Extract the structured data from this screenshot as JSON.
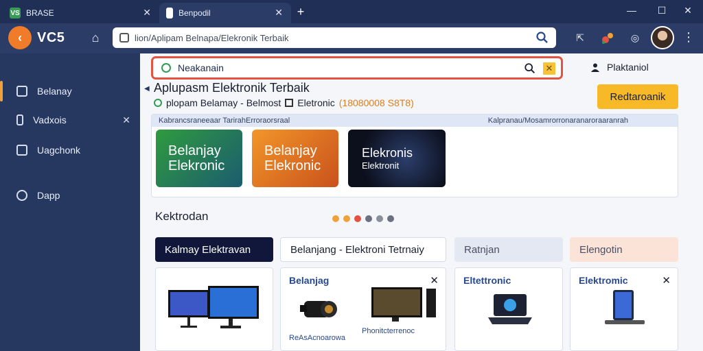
{
  "tabs": [
    {
      "label": "BRASE",
      "favicon": "VS"
    },
    {
      "label": "Benpodil",
      "favicon": ""
    }
  ],
  "toolbar": {
    "logo_text": "VC5",
    "address": "lion/Aplipam Belnapa/Elekronik Terbaik"
  },
  "sidebar": {
    "items": [
      {
        "label": "Belanay"
      },
      {
        "label": "Vadxois"
      },
      {
        "label": "Uagchonk"
      },
      {
        "label": "Dapp"
      }
    ]
  },
  "main": {
    "search_value": "Neakanain",
    "user_link": "Plaktaniol",
    "headline": "Aplupasm Elektronik Terbaik",
    "subline": {
      "part1": "plopam Belamay - Belmost",
      "part2": "Eletronic",
      "number": "(18080008 S8T8)"
    },
    "cta_label": "Redtaroanik",
    "banner": {
      "head_left": "Kabrancsraneeaar TarirahErroraorsraal",
      "head_right": "Kalpranau/Mosamrorronaranaroraaranrah",
      "tiles": [
        {
          "line1": "Belanjay",
          "line2": "Elekronic"
        },
        {
          "line1": "Belanjay",
          "line2": "Elekronic"
        },
        {
          "line1": "Elekronis",
          "line2": "Elektronit"
        }
      ]
    },
    "section_title": "Kektrodan",
    "dot_colors": [
      "#f0a23a",
      "#f0a23a",
      "#e4533f",
      "#6b7080",
      "#8a8f9c",
      "#6b7080"
    ],
    "categories": [
      {
        "label": "Kalmay Elektravan"
      },
      {
        "label": "Belanjang - Elektroni Tetrnaiy"
      },
      {
        "label": "Ratnjan"
      },
      {
        "label": "Elengotin"
      }
    ],
    "cards": [
      {
        "title": "",
        "caption": ""
      },
      {
        "title": "Belanjag",
        "caption": "ReAsAcnoarowa",
        "caption2": "Phonitcterrenoc"
      },
      {
        "title": "Eltettronic",
        "caption": ""
      },
      {
        "title": "Elektromic",
        "caption": ""
      }
    ]
  },
  "colors": {
    "sidebar_bg": "#263760",
    "accent_orange": "#f0a23a",
    "search_border": "#e4533f",
    "cta_yellow": "#f7b928"
  },
  "icons": [
    "home-icon",
    "lock-icon",
    "search-icon",
    "close-icon",
    "plus-icon",
    "user-icon",
    "menu-dots-icon"
  ]
}
